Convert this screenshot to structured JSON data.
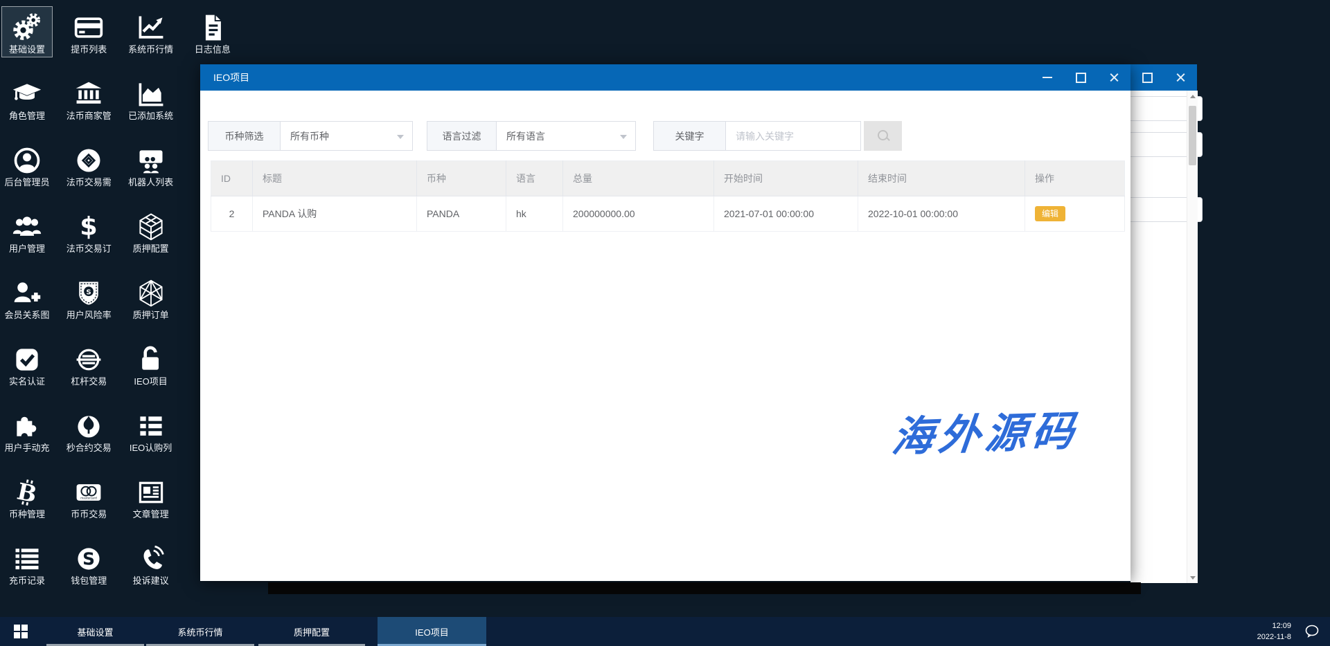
{
  "desktop": {
    "icons": [
      {
        "icon": "gears-icon",
        "label": "基础设置",
        "selected": true
      },
      {
        "icon": "graduation-cap-icon",
        "label": "角色管理"
      },
      {
        "icon": "admin-user-icon",
        "label": "后台管理员"
      },
      {
        "icon": "users-icon",
        "label": "用户管理"
      },
      {
        "icon": "user-plus-icon",
        "label": "会员关系图"
      },
      {
        "icon": "check-square-icon",
        "label": "实名认证"
      },
      {
        "icon": "puzzle-icon",
        "label": "用户手动充"
      },
      {
        "icon": "bitcoin-icon",
        "label": "币种管理"
      },
      {
        "icon": "records-list-icon",
        "label": "充币记录"
      },
      {
        "icon": "credit-card-icon",
        "label": "提币列表"
      },
      {
        "icon": "bank-icon",
        "label": "法币商家管"
      },
      {
        "icon": "fiat-trade-icon",
        "label": "法币交易需"
      },
      {
        "icon": "dollar-icon",
        "label": "法币交易订"
      },
      {
        "icon": "shield-s-icon",
        "label": "用户风险率"
      },
      {
        "icon": "leverage-icon",
        "label": "杠杆交易"
      },
      {
        "icon": "rebel-icon",
        "label": "秒合约交易"
      },
      {
        "icon": "mastercard-icon",
        "label": "币币交易"
      },
      {
        "icon": "skype-icon",
        "label": "钱包管理"
      },
      {
        "icon": "line-chart-icon",
        "label": "系统币行情"
      },
      {
        "icon": "area-chart-icon",
        "label": "已添加系统"
      },
      {
        "icon": "robot-list-icon",
        "label": "机器人列表"
      },
      {
        "icon": "cube-icon",
        "label": "质押配置"
      },
      {
        "icon": "lattice-icon",
        "label": "质押订单"
      },
      {
        "icon": "padlock-icon",
        "label": "IEO项目"
      },
      {
        "icon": "subscribe-list-icon",
        "label": "IEO认购列"
      },
      {
        "icon": "newspaper-icon",
        "label": "文章管理"
      },
      {
        "icon": "phone-icon",
        "label": "投诉建议"
      },
      {
        "icon": "document-icon",
        "label": "日志信息"
      }
    ]
  },
  "modal": {
    "title": "IEO项目",
    "filters": {
      "currency_label": "币种筛选",
      "currency_value": "所有币种",
      "language_label": "语言过滤",
      "language_value": "所有语言",
      "keyword_label": "关键字",
      "keyword_placeholder": "请输入关键字"
    },
    "table": {
      "headers": [
        "ID",
        "标题",
        "币种",
        "语言",
        "总量",
        "开始时间",
        "结束时间",
        "操作"
      ],
      "rows": [
        {
          "id": "2",
          "title": "PANDA 认购",
          "currency": "PANDA",
          "language": "hk",
          "total": "200000000.00",
          "start": "2021-07-01 00:00:00",
          "end": "2022-10-01 00:00:00",
          "action": "编辑"
        }
      ]
    }
  },
  "watermark": "海外源码",
  "taskbar": {
    "items": [
      {
        "label": "基础设置",
        "active": false
      },
      {
        "label": "系统币行情",
        "active": false
      },
      {
        "label": "质押配置",
        "active": false
      },
      {
        "label": "IEO项目",
        "active": true
      }
    ],
    "clock": {
      "time": "12:09",
      "date": "2022-11-8"
    }
  },
  "colors": {
    "desktop_bg": "#0d1b28",
    "titlebar_blue": "#0667b6",
    "taskbar_bg": "#0c1f3a",
    "taskbar_active": "#1d4b76",
    "edit_button": "#efb336",
    "watermark_blue": "#2e6cd9"
  }
}
